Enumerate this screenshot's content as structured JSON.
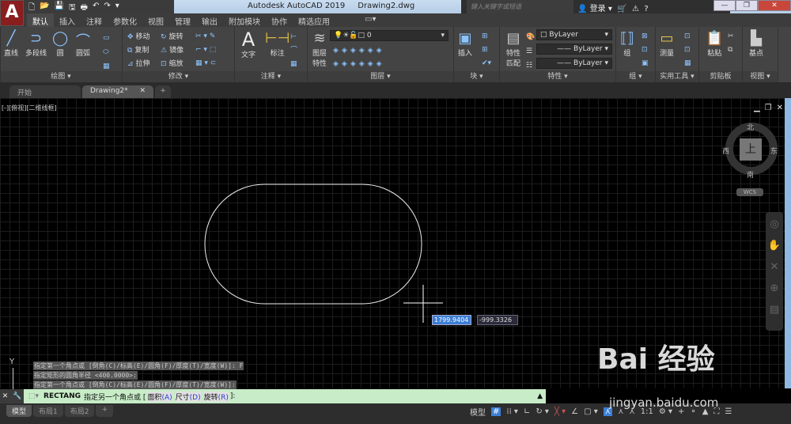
{
  "app": {
    "logo": "A",
    "title": "Autodesk AutoCAD 2019",
    "file": "Drawing2.dwg",
    "search_placeholder": "键入关键字或短语",
    "login": "登录",
    "help": "?",
    "min": "—",
    "restore": "❐",
    "close": "✕"
  },
  "ribbon_tabs": [
    "默认",
    "插入",
    "注释",
    "参数化",
    "视图",
    "管理",
    "输出",
    "附加模块",
    "协作",
    "精选应用"
  ],
  "panels": {
    "draw": {
      "label": "绘图 ▾",
      "tools": [
        "直线",
        "多段线",
        "圆",
        "圆弧"
      ]
    },
    "modify": {
      "label": "修改 ▾",
      "rows": [
        "移动",
        "旋转",
        "复制",
        "镜像",
        "拉伸",
        "缩放"
      ]
    },
    "annotation": {
      "label": "注释 ▾",
      "tools": [
        "文字",
        "标注"
      ]
    },
    "layers": {
      "label": "图层 ▾",
      "tool": "图层特性",
      "layer_value": "0"
    },
    "block": {
      "label": "块 ▾",
      "tool": "插入"
    },
    "properties": {
      "label": "特性 ▾",
      "tool": "特性匹配",
      "color": "ByLayer",
      "linetype": "ByLayer",
      "lineweight": "ByLayer"
    },
    "group": {
      "label": "组 ▾",
      "tool": "组"
    },
    "utilities": {
      "label": "实用工具 ▾",
      "tool": "测量"
    },
    "clipboard": {
      "label": "剪贴板",
      "tool": "粘贴"
    },
    "view": {
      "label": "视图 ▾",
      "tool": "基点"
    }
  },
  "doc_tabs": [
    "开始",
    "Drawing2*",
    "+"
  ],
  "viewport": {
    "label": "[-][俯视][二维线框]",
    "cube": {
      "top": "上",
      "n": "北",
      "s": "南",
      "e": "东",
      "w": "西",
      "wcs": "WCS"
    }
  },
  "dynamic_input": {
    "x": "1799.9404",
    "y": "-999.3326"
  },
  "history": [
    "指定第一个角点或 [倒角(C)/标高(E)/圆角(F)/厚度(T)/宽度(W)]: F",
    "指定矩形的圆角半径 <400.0000>:",
    "指定第一个角点或 [倒角(C)/标高(E)/圆角(F)/厚度(T)/宽度(W)]:"
  ],
  "command": {
    "name": "RECTANG",
    "prompt": "指定另一个角点或 [",
    "o1": "面积",
    "k1": "(A)",
    "o2": "尺寸",
    "k2": "(D)",
    "o3": "旋转",
    "k3": "(R)",
    "end": "]:"
  },
  "layout_tabs": [
    "模型",
    "布局1",
    "布局2",
    "+"
  ],
  "status": {
    "model": "模型",
    "scale": "1:1"
  },
  "axis": "Y",
  "watermark": "Bai 经验",
  "watermark_url": "jingyan.baidu.com",
  "colors": {
    "accent": "#3d7fd6",
    "command_bg": "#c7ecc7"
  }
}
